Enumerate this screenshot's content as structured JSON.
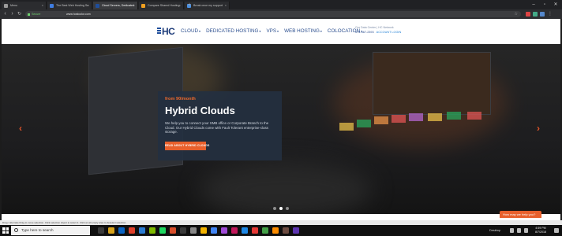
{
  "browser": {
    "tabs": [
      {
        "label": "Menu",
        "color": "#9a9a9a",
        "active": false
      },
      {
        "label": "The Best Web Hosting Se",
        "color": "#3f7de0",
        "active": false
      },
      {
        "label": "Cloud Servers, Dedicated",
        "color": "#1f4e9c",
        "active": true
      },
      {
        "label": "Compare Shared Hosting",
        "color": "#f0a020",
        "active": false
      },
      {
        "label": "Break once my support",
        "color": "#4a90e2",
        "active": false
      }
    ],
    "secure_label": "Secure",
    "url": "www.hostcolor.com",
    "new_tab": "+",
    "star_icon": "star-icon"
  },
  "site": {
    "logo_text": "HC",
    "nav": [
      {
        "label": "CLOUD",
        "caret": "▾"
      },
      {
        "label": "DEDICATED HOSTING",
        "caret": "▾"
      },
      {
        "label": "VPS",
        "caret": "▾"
      },
      {
        "label": "WEB HOSTING",
        "caret": "▾"
      },
      {
        "label": "COLOCATION",
        "caret": "▾"
      }
    ],
    "contact_line1": "Our Data Center | HC Network",
    "phone": "574-367-2393",
    "account_login": "ACCOUNT LOGIN"
  },
  "hero": {
    "pre_title": "from 90/month",
    "title": "Hybrid Clouds",
    "body": "We help you to connect your SMB office or Corporate Branch to the Cloud. Our Hybrid Clouds come with Fault Tolerant enterprise-class storage.",
    "cta": "READ ABOUT HYBRID CLOUDS",
    "prev_arrow": "‹",
    "next_arrow": "›",
    "slides": 3,
    "active_slide": 1
  },
  "chat": {
    "label": "How may we help you?"
  },
  "status_bar": {
    "text": "Drag / alternate Drag to move selection. Click selection object to select it. Click an all empty area to deselect selection."
  },
  "taskbar": {
    "search_placeholder": "Type here to search",
    "desktop_label": "Desktop",
    "time": "4:59 PM",
    "date": "8/7/2018",
    "app_colors": [
      "#3a3a3a",
      "#d8a31b",
      "#0a64c4",
      "#e0402a",
      "#2b7cd3",
      "#7fba00",
      "#1ed760",
      "#d94f2b",
      "#3a3a3a",
      "#888888",
      "#f4b400",
      "#4285f4",
      "#a04bd8",
      "#c2185b",
      "#1e88e5",
      "#e53935",
      "#43a047",
      "#fb8c00",
      "#6d4c41",
      "#5e35b1"
    ]
  }
}
